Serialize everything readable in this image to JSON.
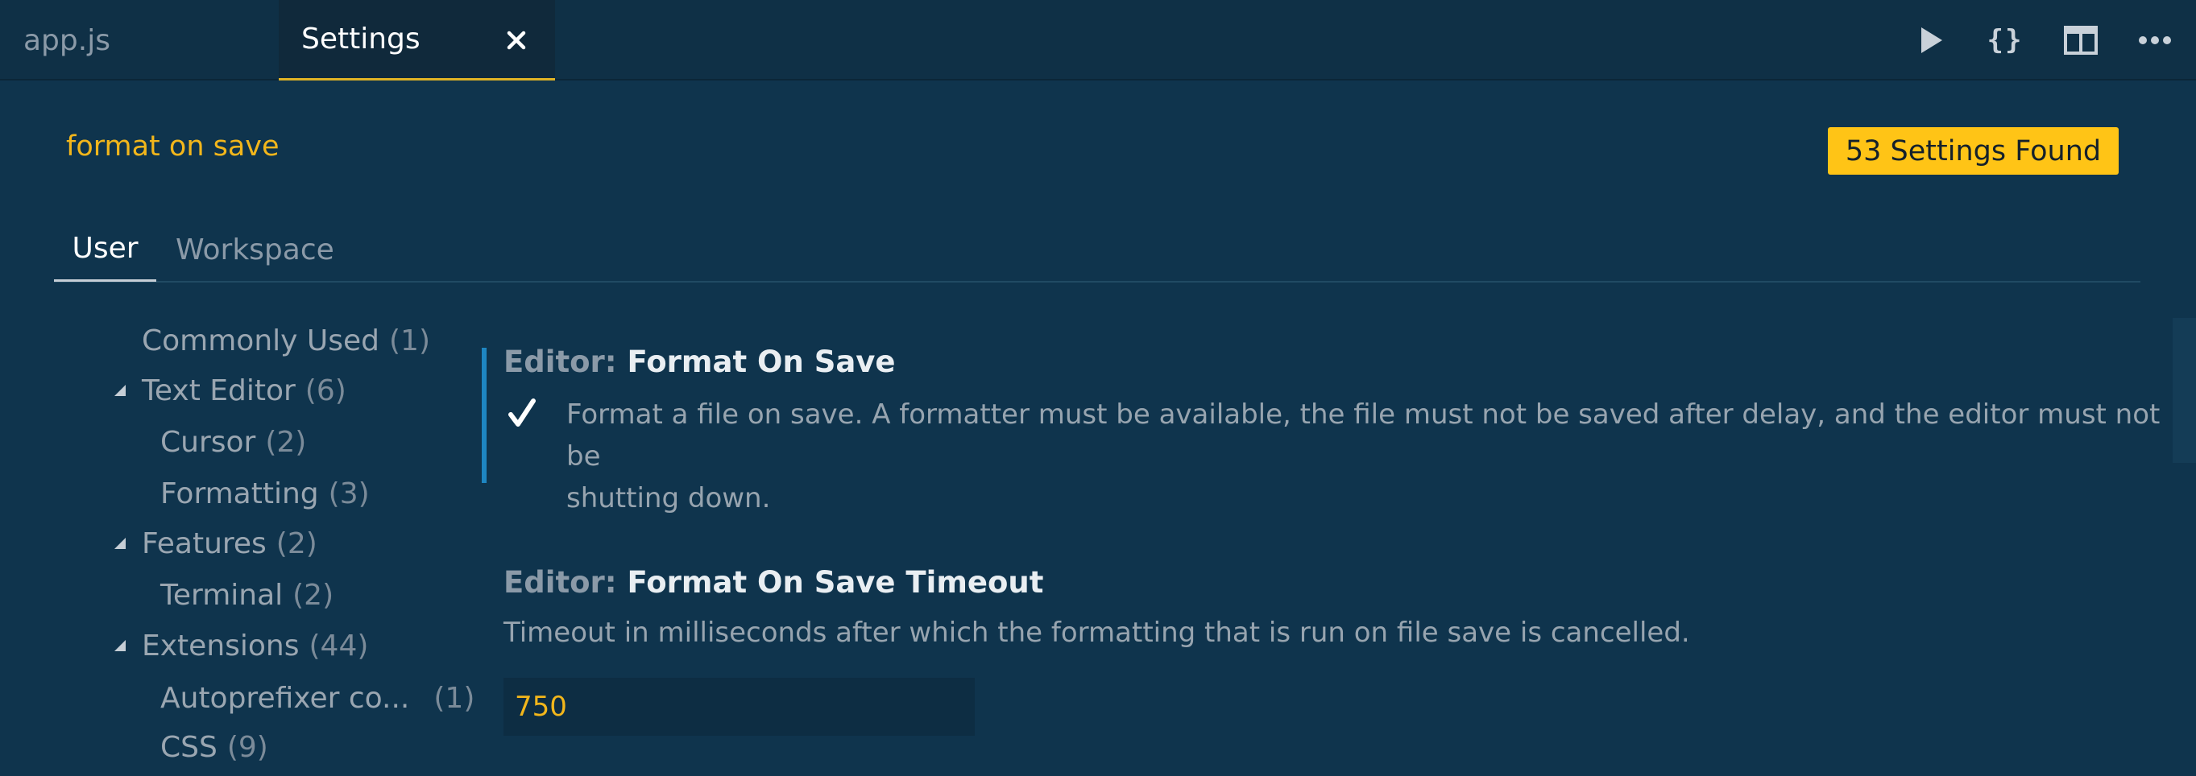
{
  "tabs": [
    {
      "label": "app.js"
    },
    {
      "label": "Settings"
    }
  ],
  "search": {
    "value": "format on save",
    "results_label": "53 Settings Found"
  },
  "scopes": [
    {
      "label": "User"
    },
    {
      "label": "Workspace"
    }
  ],
  "tree": [
    {
      "label": "Commonly Used",
      "count": "(1)"
    },
    {
      "label": "Text Editor",
      "count": "(6)"
    },
    {
      "label": "Cursor",
      "count": "(2)"
    },
    {
      "label": "Formatting",
      "count": "(3)"
    },
    {
      "label": "Features",
      "count": "(2)"
    },
    {
      "label": "Terminal",
      "count": "(2)"
    },
    {
      "label": "Extensions",
      "count": "(44)"
    },
    {
      "label": "Autoprefixer co...",
      "count": "(1)"
    },
    {
      "label": "CSS",
      "count": "(9)"
    }
  ],
  "settings": [
    {
      "category": "Editor: ",
      "name": "Format On Save",
      "description_line1": "Format a file on save. A formatter must be available, the file must not be saved after delay, and the editor must not be",
      "description_line2": "shutting down.",
      "checked": true
    },
    {
      "category": "Editor: ",
      "name": "Format On Save Timeout",
      "description": "Timeout in milliseconds after which the formatting that is run on file save is cancelled.",
      "value": "750"
    }
  ],
  "icons": {
    "close": "close-icon",
    "run": "play-icon",
    "json": "braces-icon",
    "split": "split-editor-icon",
    "more": "more-icon",
    "check": "check-icon",
    "twisty": "expand-triangle-icon"
  },
  "colors": {
    "background": "#0f344d",
    "accent": "#ffc416",
    "search_text": "#f2b61b",
    "focus": "#1e86c2"
  }
}
